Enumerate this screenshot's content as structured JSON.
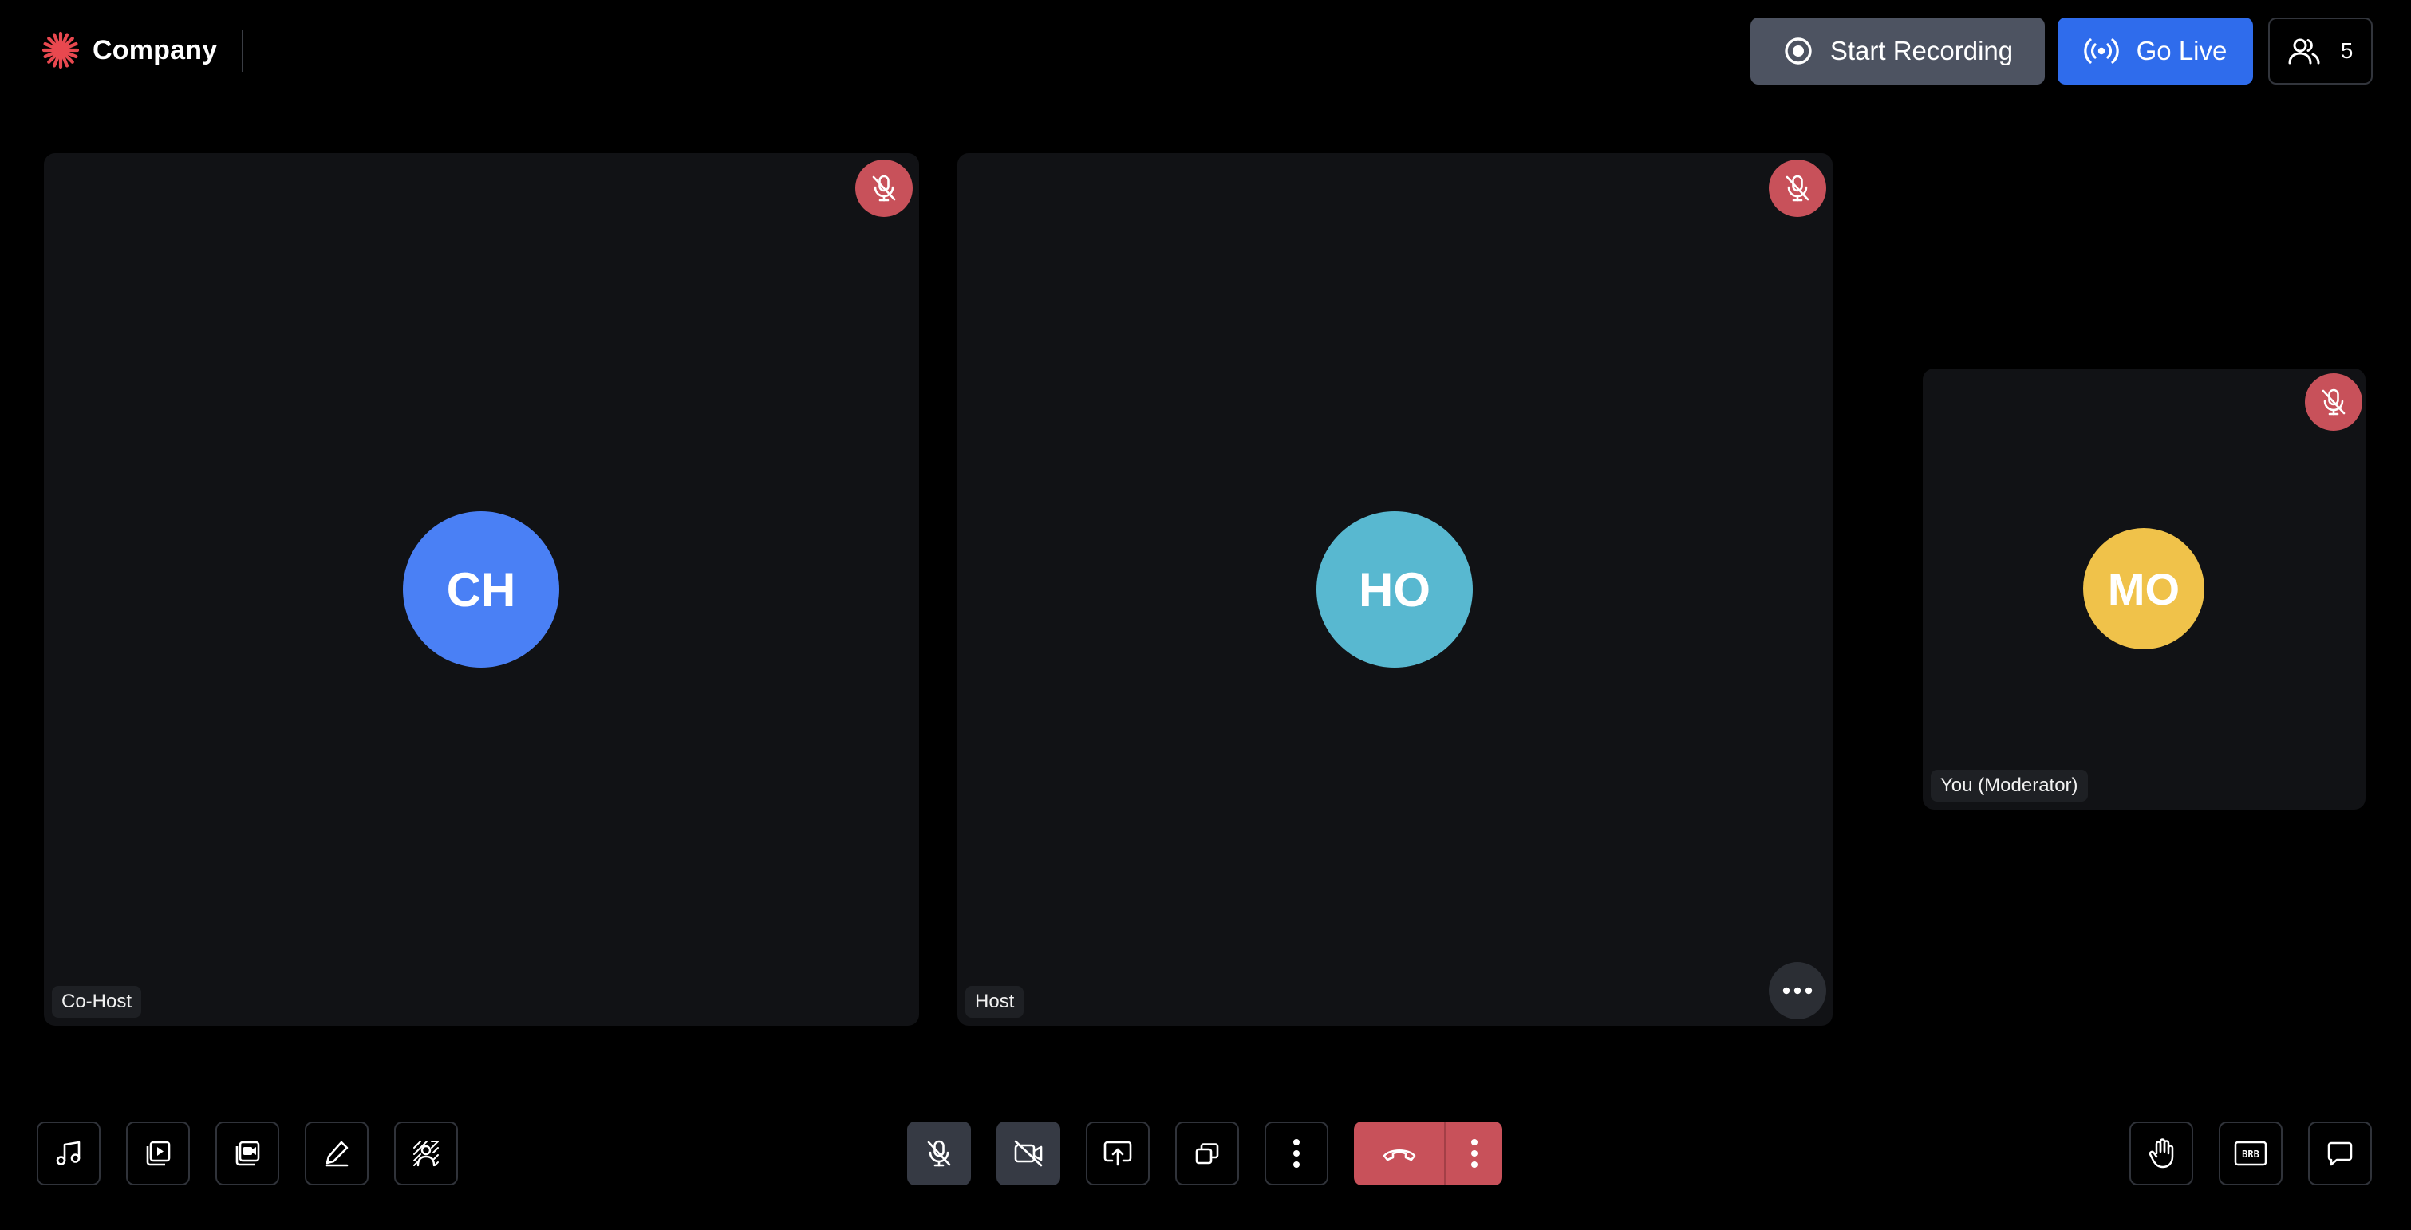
{
  "brand": {
    "name": "Company",
    "logo_icon": "sunburst-logo-icon",
    "logo_color": "#e9484f"
  },
  "header": {
    "record_button": {
      "label": "Start Recording",
      "icon": "record-circle-icon",
      "bg": "#4d5361"
    },
    "live_button": {
      "label": "Go Live",
      "icon": "broadcast-icon",
      "bg": "#2f6cec"
    },
    "participants_button": {
      "count": "5",
      "icon": "users-icon"
    }
  },
  "tiles": [
    {
      "id": "cohost",
      "initials": "CH",
      "name": "Co-Host",
      "avatar_color": "#4a80f5",
      "muted": true
    },
    {
      "id": "host",
      "initials": "HO",
      "name": "Host",
      "avatar_color": "#58b8d0",
      "muted": true,
      "has_menu": true
    },
    {
      "id": "moderator",
      "initials": "MO",
      "name": "You (Moderator)",
      "avatar_color": "#f0c24a",
      "muted": true
    }
  ],
  "toolbar": {
    "left": [
      {
        "icon": "music-icon"
      },
      {
        "icon": "play-video-icon"
      },
      {
        "icon": "media-library-icon"
      },
      {
        "icon": "pen-icon"
      },
      {
        "icon": "virtual-background-icon"
      }
    ],
    "center": [
      {
        "icon": "mic-off-icon",
        "state": "off"
      },
      {
        "icon": "video-off-icon",
        "state": "off"
      },
      {
        "icon": "share-screen-icon"
      },
      {
        "icon": "layout-icon"
      },
      {
        "icon": "more-vertical-icon"
      }
    ],
    "leave": {
      "icon": "hang-up-icon",
      "more_icon": "more-vertical-icon",
      "color": "#c8515a"
    },
    "right": [
      {
        "icon": "raise-hand-icon"
      },
      {
        "icon": "brb-icon",
        "text": "BRB"
      },
      {
        "icon": "chat-icon"
      }
    ]
  }
}
